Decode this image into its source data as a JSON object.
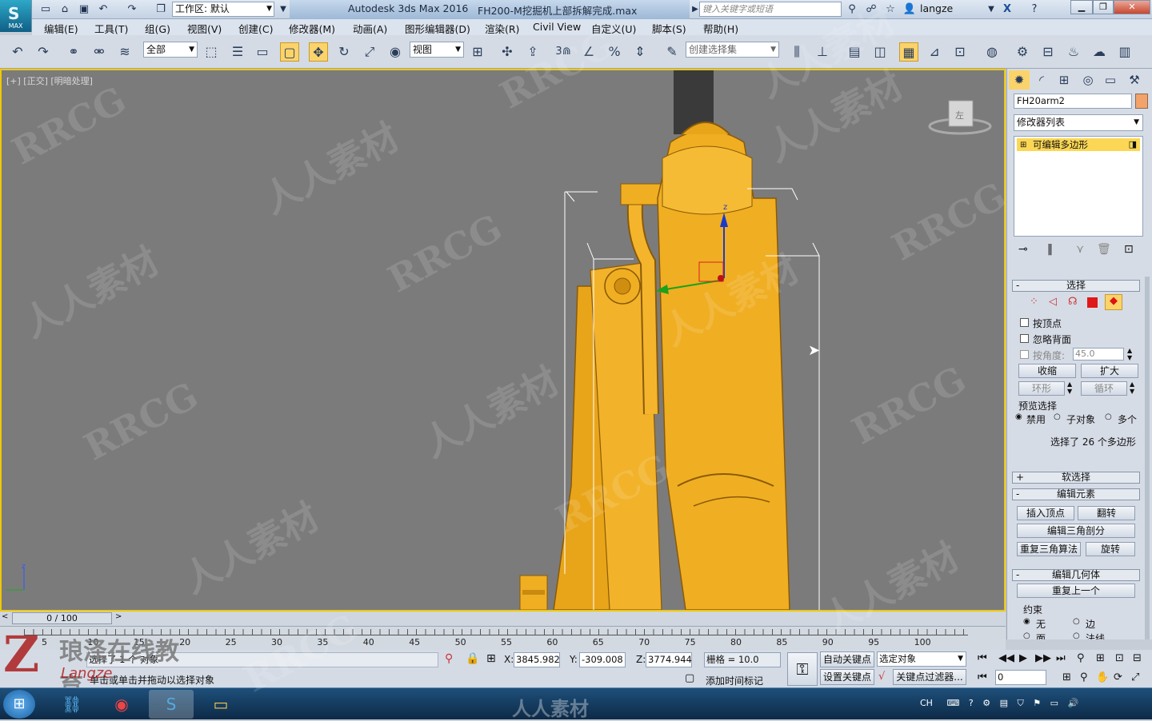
{
  "title_bar": {
    "app_logo": "MAX",
    "workspace_label": "工作区: 默认",
    "app_title": "Autodesk 3ds Max 2016",
    "document": "FH200-M挖掘机上部拆解完成.max",
    "search_placeholder": "键入关键字或短语",
    "user": "langze"
  },
  "menu": [
    "编辑(E)",
    "工具(T)",
    "组(G)",
    "视图(V)",
    "创建(C)",
    "修改器(M)",
    "动画(A)",
    "图形编辑器(D)",
    "渲染(R)",
    "Civil View",
    "自定义(U)",
    "脚本(S)",
    "帮助(H)"
  ],
  "toolbar": {
    "filter_value": "全部",
    "coord_system": "视图",
    "snap_value": "3",
    "named_selection": "创建选择集"
  },
  "viewport": {
    "label": "[+] [正交] [明暗处理]",
    "viewcube_face": "左",
    "axis_z": "z"
  },
  "command_panel": {
    "object_name": "FH20arm2",
    "object_color": "#f2a36a",
    "modifier_list": "修改器列表",
    "stack_item": "可编辑多边形",
    "selection_rollout": "选择",
    "by_vertex": "按顶点",
    "ignore_backfacing": "忽略背面",
    "by_angle": "按角度:",
    "angle_value": "45.0",
    "shrink": "收缩",
    "grow": "扩大",
    "ring": "环形",
    "loop": "循环",
    "preview_selection": "预览选择",
    "preview_options": [
      "禁用",
      "子对象",
      "多个"
    ],
    "selection_info": "选择了 26 个多边形",
    "soft_selection": "软选择",
    "edit_elements": "编辑元素",
    "insert_vertex": "插入顶点",
    "flip": "翻转",
    "edit_triangulation": "编辑三角剖分",
    "retriangulate": "重复三角算法",
    "turn": "旋转",
    "edit_geometry": "编辑几何体",
    "repeat_last": "重复上一个",
    "constraints": "约束",
    "constraint_options": [
      "无",
      "边",
      "面",
      "法线"
    ]
  },
  "timeline": {
    "frame_display": "0 / 100",
    "ticks": [
      "5",
      "10",
      "15",
      "20",
      "25",
      "30",
      "35",
      "40",
      "45",
      "50",
      "55",
      "60",
      "65",
      "70",
      "75",
      "80",
      "85",
      "90",
      "95",
      "100"
    ]
  },
  "status": {
    "selected_text": "选择了 1 个 对象",
    "prompt_text": "单击或单击并拖动以选择对象",
    "x_label": "X:",
    "x_value": "3845.982",
    "y_label": "Y:",
    "y_value": "-309.008",
    "z_label": "Z:",
    "z_value": "3774.944",
    "grid": "栅格 = 10.0",
    "add_time_tag": "添加时间标记",
    "auto_key": "自动关键点",
    "set_key": "设置关键点",
    "key_mode": "选定对象",
    "key_filters": "关键点过滤器...",
    "current_frame": "0"
  },
  "taskbar": {
    "tray_lang": "CH"
  },
  "watermarks": [
    "RRCG",
    "人人素材",
    "RRCG",
    "人人素材",
    "RRCG",
    "人人素材",
    "RRCG",
    "人人素材",
    "RRCG",
    "人人素材",
    "RRCG",
    "人人素材",
    "RRCG",
    "人人素材",
    "RRCG",
    "人人素材"
  ],
  "brand_overlay": {
    "name": "琅泽在线教育",
    "sub": "Langze",
    "bottom": "人人素材"
  }
}
